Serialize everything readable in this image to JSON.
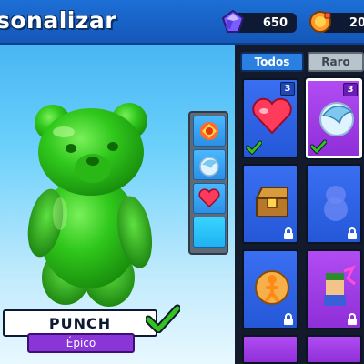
{
  "header": {
    "title": "sonalizar",
    "gems": "650",
    "coins": "20"
  },
  "character": {
    "name": "PUNCH",
    "rarity": "Épico",
    "color": "#2fc81a"
  },
  "slots": [
    {
      "icon": "punch-emote-icon"
    },
    {
      "icon": "dolphin-emote-icon"
    },
    {
      "icon": "heart-emote-icon"
    },
    {
      "icon": "empty-slot"
    }
  ],
  "tabs": [
    {
      "label": "Todos",
      "active": true
    },
    {
      "label": "Raro",
      "active": false
    }
  ],
  "cards": [
    {
      "icon": "heart-icon",
      "count": "3",
      "rarity": "blue",
      "equipped": true
    },
    {
      "icon": "dolphin-icon",
      "count": "3",
      "rarity": "purple",
      "equipped": true,
      "selected": true
    },
    {
      "icon": "treasure-chest-icon",
      "rarity": "blue",
      "locked": true
    },
    {
      "icon": "ghost-character-icon",
      "rarity": "blue",
      "locked": true
    },
    {
      "icon": "running-figure-icon",
      "rarity": "blue",
      "locked": true
    },
    {
      "icon": "character-portrait-icon",
      "rarity": "purple",
      "locked": true
    }
  ],
  "colors": {
    "accent": "#2a7fe0",
    "epic": "#8a35d8",
    "check": "#35c21a"
  }
}
